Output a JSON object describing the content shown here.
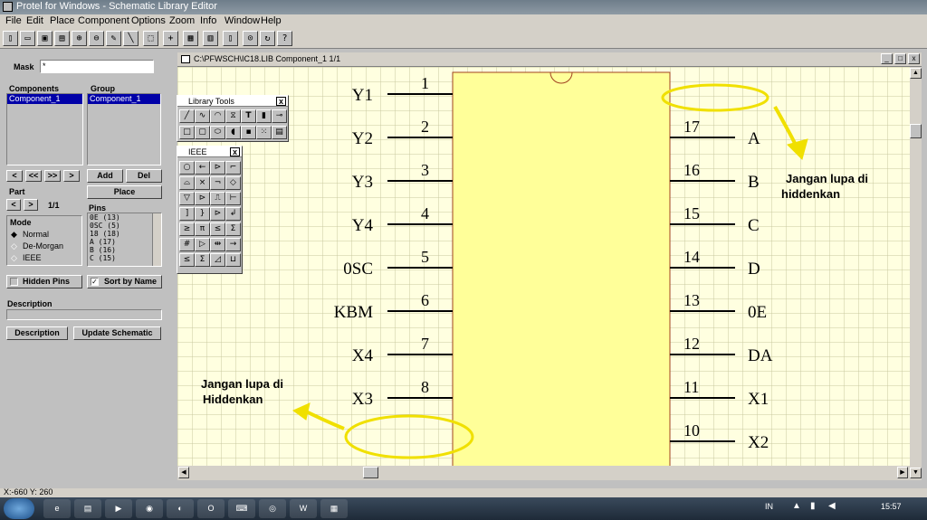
{
  "window": {
    "title": "Protel for Windows - Schematic Library Editor"
  },
  "menu": [
    "File",
    "Edit",
    "Place",
    "Component",
    "Options",
    "Zoom",
    "Info",
    "Window",
    "Help"
  ],
  "toolbar": {
    "help_label": "?"
  },
  "left_panel": {
    "mask_label": "Mask",
    "mask_value": "*",
    "components_label": "Components",
    "group_label": "Group",
    "components_list": [
      "Component_1"
    ],
    "group_list": [
      "Component_1"
    ],
    "nav": {
      "first": "<",
      "prev": "<<",
      "next": ">>",
      "last": ">"
    },
    "add_label": "Add",
    "del_label": "Del",
    "place_label": "Place",
    "part_label": "Part",
    "part_prev": "<",
    "part_next": ">",
    "part_value": "1/1",
    "pins_label": "Pins",
    "pins_list": [
      "0E  (13)",
      "0SC  (5)",
      "18  (18)",
      "A  (17)",
      "B  (16)",
      "C  (15)"
    ],
    "mode_label": "Mode",
    "mode_normal": "Normal",
    "mode_demorgan": "De-Morgan",
    "mode_ieee": "IEEE",
    "hidden_pins_label": "Hidden Pins",
    "sort_by_name_label": "Sort by Name",
    "description_label": "Description",
    "description_button": "Description",
    "update_button": "Update Schematic"
  },
  "document": {
    "title": "C:\\PFWSCH\\IC18.LIB  Component_1 1/1",
    "min": "_",
    "max": "□",
    "close": "x"
  },
  "palettes": {
    "library_tools": {
      "title": "Library Tools",
      "close": "x",
      "text_tool": "T"
    },
    "ieee": {
      "title": "IEEE",
      "close": "x",
      "hash": "#"
    }
  },
  "schematic": {
    "left_pins": [
      {
        "name": "Y1",
        "num": "1"
      },
      {
        "name": "Y2",
        "num": "2"
      },
      {
        "name": "Y3",
        "num": "3"
      },
      {
        "name": "Y4",
        "num": "4"
      },
      {
        "name": "0SC",
        "num": "5"
      },
      {
        "name": "KBM",
        "num": "6"
      },
      {
        "name": "X4",
        "num": "7"
      },
      {
        "name": "X3",
        "num": "8"
      }
    ],
    "right_pins": [
      {
        "name": "A",
        "num": "17"
      },
      {
        "name": "B",
        "num": "16"
      },
      {
        "name": "C",
        "num": "15"
      },
      {
        "name": "D",
        "num": "14"
      },
      {
        "name": "0E",
        "num": "13"
      },
      {
        "name": "DA",
        "num": "12"
      },
      {
        "name": "X1",
        "num": "11"
      },
      {
        "name": "X2",
        "num": "10"
      }
    ],
    "annotation_right": [
      "Jangan lupa di",
      "hiddenkan"
    ],
    "annotation_left": [
      "Jangan lupa di",
      "Hiddenkan"
    ],
    "colors": {
      "body": "#ffff99",
      "body_border": "#a04020",
      "highlight": "#f0e000",
      "grid": "#c8c8a0"
    }
  },
  "status": {
    "coords": "X:-660 Y: 260"
  },
  "taskbar": {
    "lang": "IN",
    "clock": "15:57"
  }
}
